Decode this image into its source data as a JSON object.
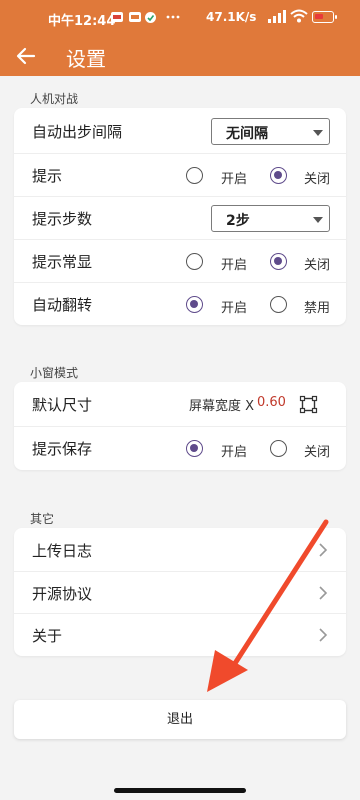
{
  "status_bar": {
    "time": "中午12:44",
    "network_speed": "47.1K/s"
  },
  "app_bar": {
    "title": "设置"
  },
  "sections": {
    "pve": {
      "title": "人机对战",
      "auto_step": {
        "label": "自动出步间隔",
        "value": "无间隔"
      },
      "hint": {
        "label": "提示",
        "on": "开启",
        "off": "关闭",
        "selected": "off"
      },
      "hint_steps": {
        "label": "提示步数",
        "value": "2步"
      },
      "hint_always": {
        "label": "提示常显",
        "on": "开启",
        "off": "关闭",
        "selected": "off"
      },
      "auto_flip": {
        "label": "自动翻转",
        "on": "开启",
        "off": "禁用",
        "selected": "on"
      }
    },
    "mini": {
      "title": "小窗模式",
      "default_size": {
        "label": "默认尺寸",
        "text": "屏幕宽度 X",
        "value": "0.60"
      },
      "hint_save": {
        "label": "提示保存",
        "on": "开启",
        "off": "关闭",
        "selected": "on"
      }
    },
    "other": {
      "title": "其它",
      "items": [
        "上传日志",
        "开源协议",
        "关于"
      ]
    }
  },
  "exit_label": "退出",
  "colors": {
    "accent": "#e0793a",
    "radio": "#5f4b8b",
    "value_red": "#c0392b",
    "annotation_arrow": "#f04a2c"
  }
}
